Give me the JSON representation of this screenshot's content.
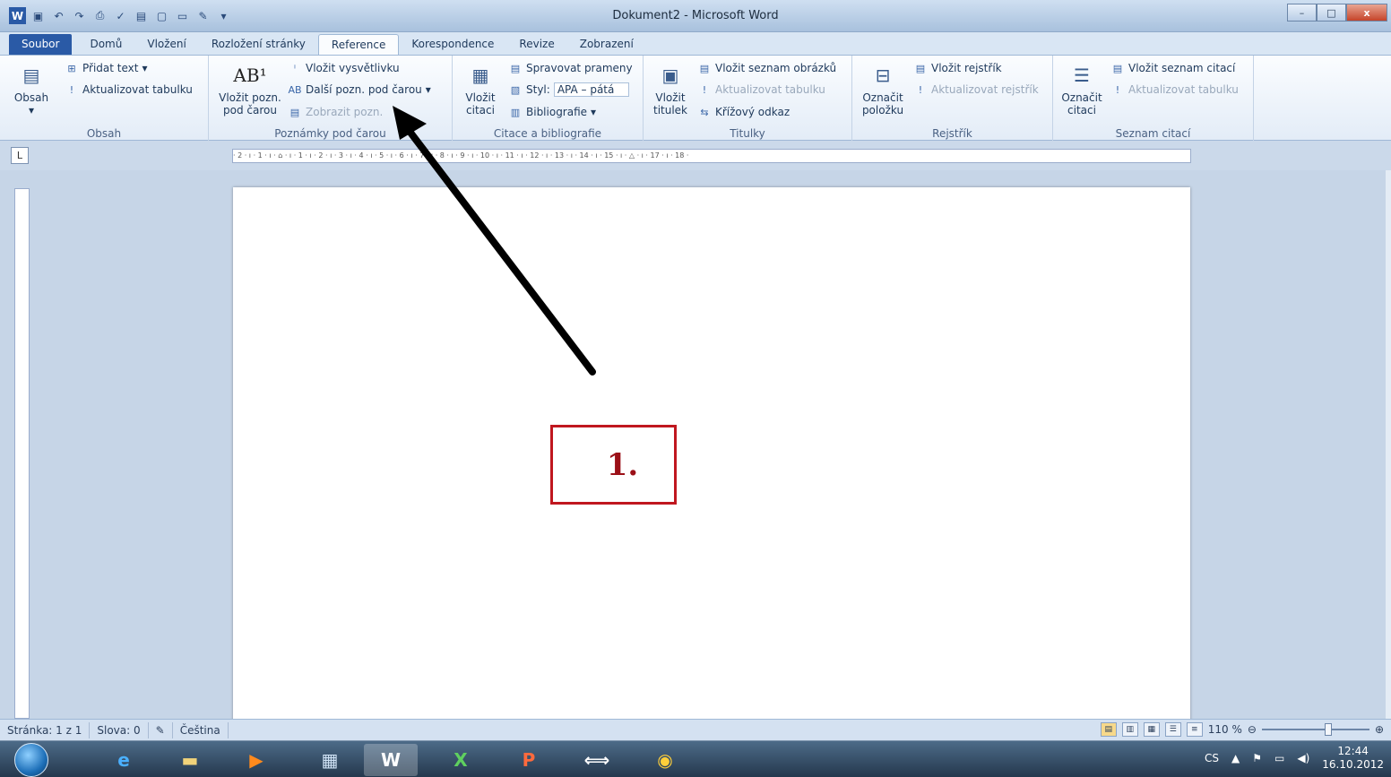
{
  "window": {
    "title": "Dokument2 - Microsoft Word",
    "min": "–",
    "max": "□",
    "close": "x"
  },
  "tabs": [
    "Soubor",
    "Domů",
    "Vložení",
    "Rozložení stránky",
    "Reference",
    "Korespondence",
    "Revize",
    "Zobrazení"
  ],
  "ribbon": {
    "obsah": {
      "big": "Obsah",
      "add_text": "Přidat text",
      "update_table": "Aktualizovat tabulku",
      "label": "Obsah"
    },
    "footnotes": {
      "big1": "Vložit pozn.",
      "big2": "pod čarou",
      "insert_endnote": "Vložit vysvětlivku",
      "next_footnote": "Další pozn. pod čarou",
      "show_notes": "Zobrazit pozn.",
      "label": "Poznámky pod čarou"
    },
    "citations": {
      "big1": "Vložit",
      "big2": "citaci",
      "manage": "Spravovat prameny",
      "style_label": "Styl:",
      "style_value": "APA – pátá",
      "bibliography": "Bibliografie",
      "label": "Citace a bibliografie"
    },
    "captions": {
      "big1": "Vložit",
      "big2": "titulek",
      "insert_tof": "Vložit seznam obrázků",
      "update_table": "Aktualizovat tabulku",
      "crossref": "Křížový odkaz",
      "label": "Titulky"
    },
    "index": {
      "big1": "Označit",
      "big2": "položku",
      "insert_index": "Vložit rejstřík",
      "update_index": "Aktualizovat rejstřík",
      "label": "Rejstřík"
    },
    "toa": {
      "big1": "Označit",
      "big2": "citaci",
      "insert_toa": "Vložit seznam citací",
      "update_table": "Aktualizovat tabulku",
      "label": "Seznam citací"
    }
  },
  "ruler": {
    "marks": "· 2 · ı · 1 · ı · ⌂ · ı · 1 · ı · 2 · ı · 3 · ı · 4 · ı · 5 · ı · 6 · ı · 7 · ı · 8 · ı · 9 · ı · 10 · ı · 11 · ı · 12 · ı · 13 · ı · 14 · ı · 15 · ı · △ · ı · 17 · ı · 18 ·",
    "tab": "L"
  },
  "callout": {
    "text": "1."
  },
  "status": {
    "page": "Stránka: 1 z 1",
    "words": "Slova: 0",
    "language": "Čeština",
    "zoom": "110 %"
  },
  "tray": {
    "lang": "CS",
    "time": "12:44",
    "date": "16.10.2012"
  }
}
